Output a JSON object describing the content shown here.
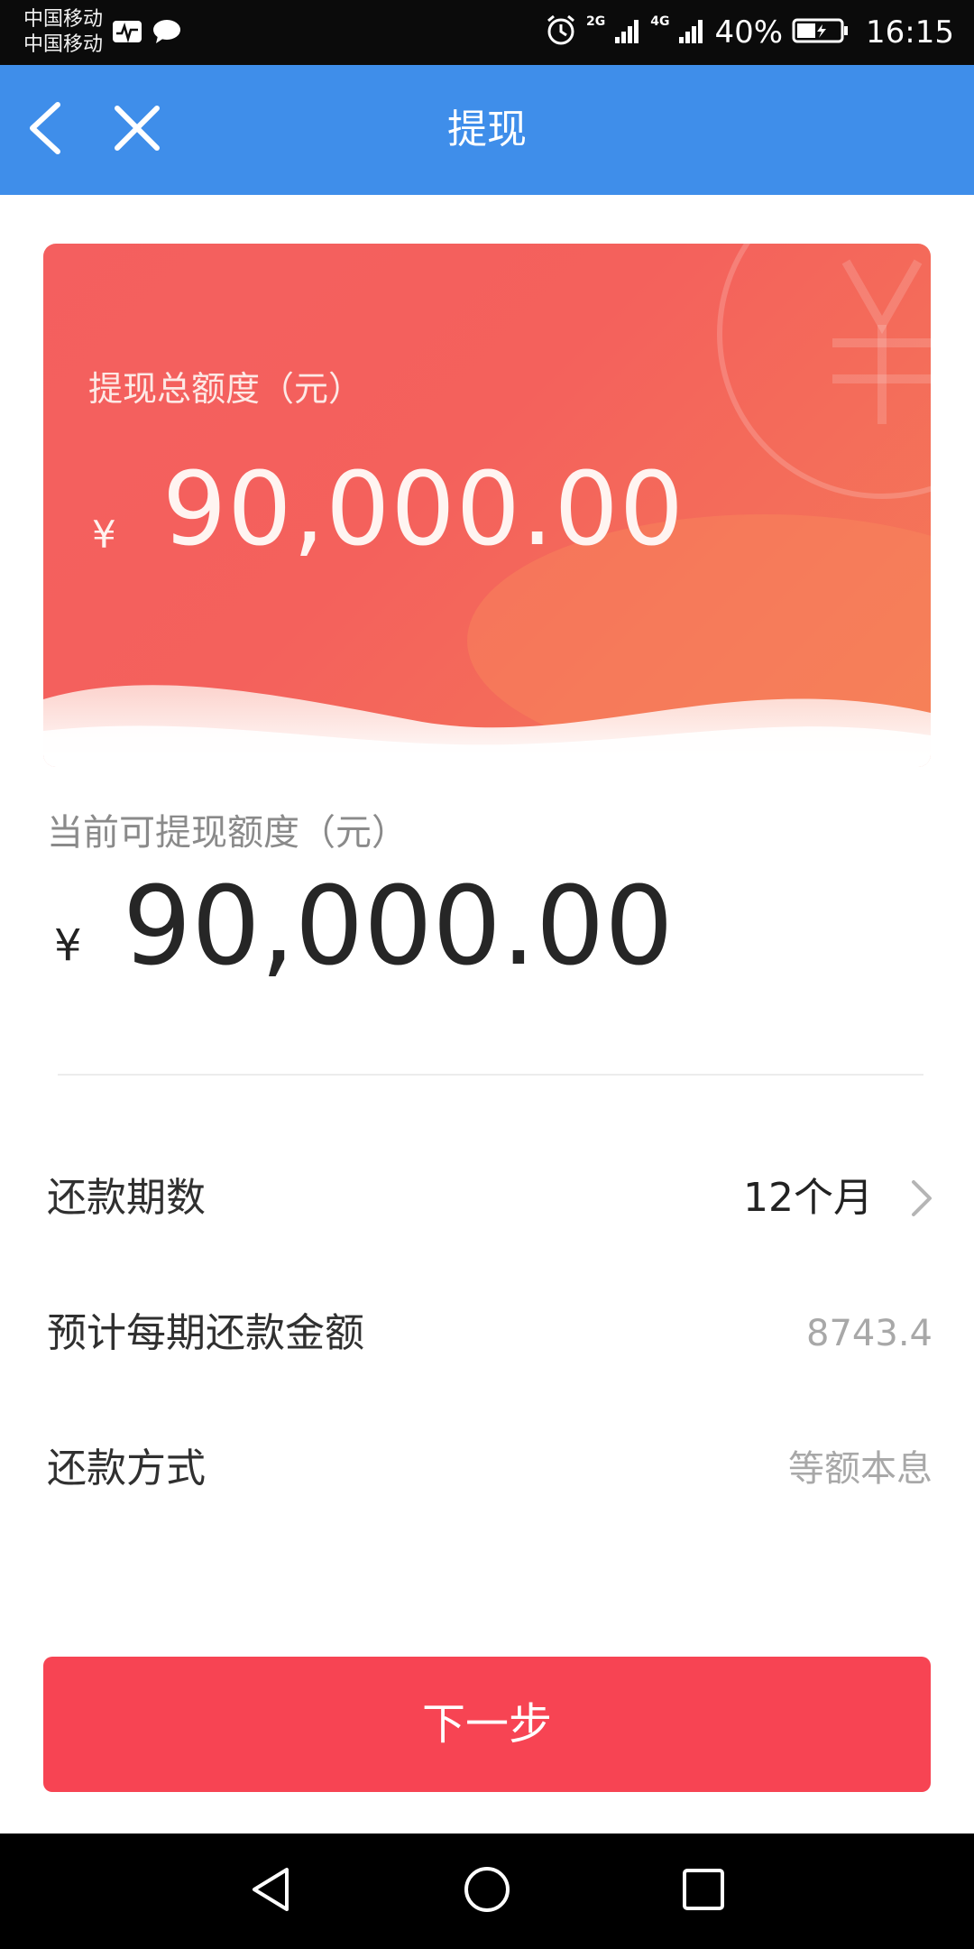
{
  "status_bar": {
    "carrier_1": "中国移动",
    "carrier_2": "中国移动",
    "network_1": "2G",
    "network_2": "4G",
    "battery_percent": "40%",
    "time": "16:15",
    "icons": [
      "activity-icon",
      "chat-icon",
      "alarm-icon",
      "signal-icon",
      "battery-icon"
    ]
  },
  "nav": {
    "title": "提现",
    "back_icon": "chevron-left-icon",
    "close_icon": "close-icon",
    "bar_color": "#3f8eea"
  },
  "card": {
    "label": "提现总额度（元）",
    "currency": "¥",
    "amount": "90,000.00",
    "decoration_icon": "yuan-icon"
  },
  "available": {
    "label": "当前可提现额度（元）",
    "currency": "¥",
    "amount": "90,000.00"
  },
  "rows": {
    "term": {
      "label": "还款期数",
      "value": "12个月"
    },
    "payment": {
      "label": "预计每期还款金额",
      "value": "8743.4"
    },
    "method": {
      "label": "还款方式",
      "value": "等额本息"
    }
  },
  "next_button": {
    "label": "下一步",
    "color": "#f74453"
  },
  "system_nav": {
    "back_icon": "triangle-back-icon",
    "home_icon": "circle-home-icon",
    "recent_icon": "square-recent-icon"
  }
}
